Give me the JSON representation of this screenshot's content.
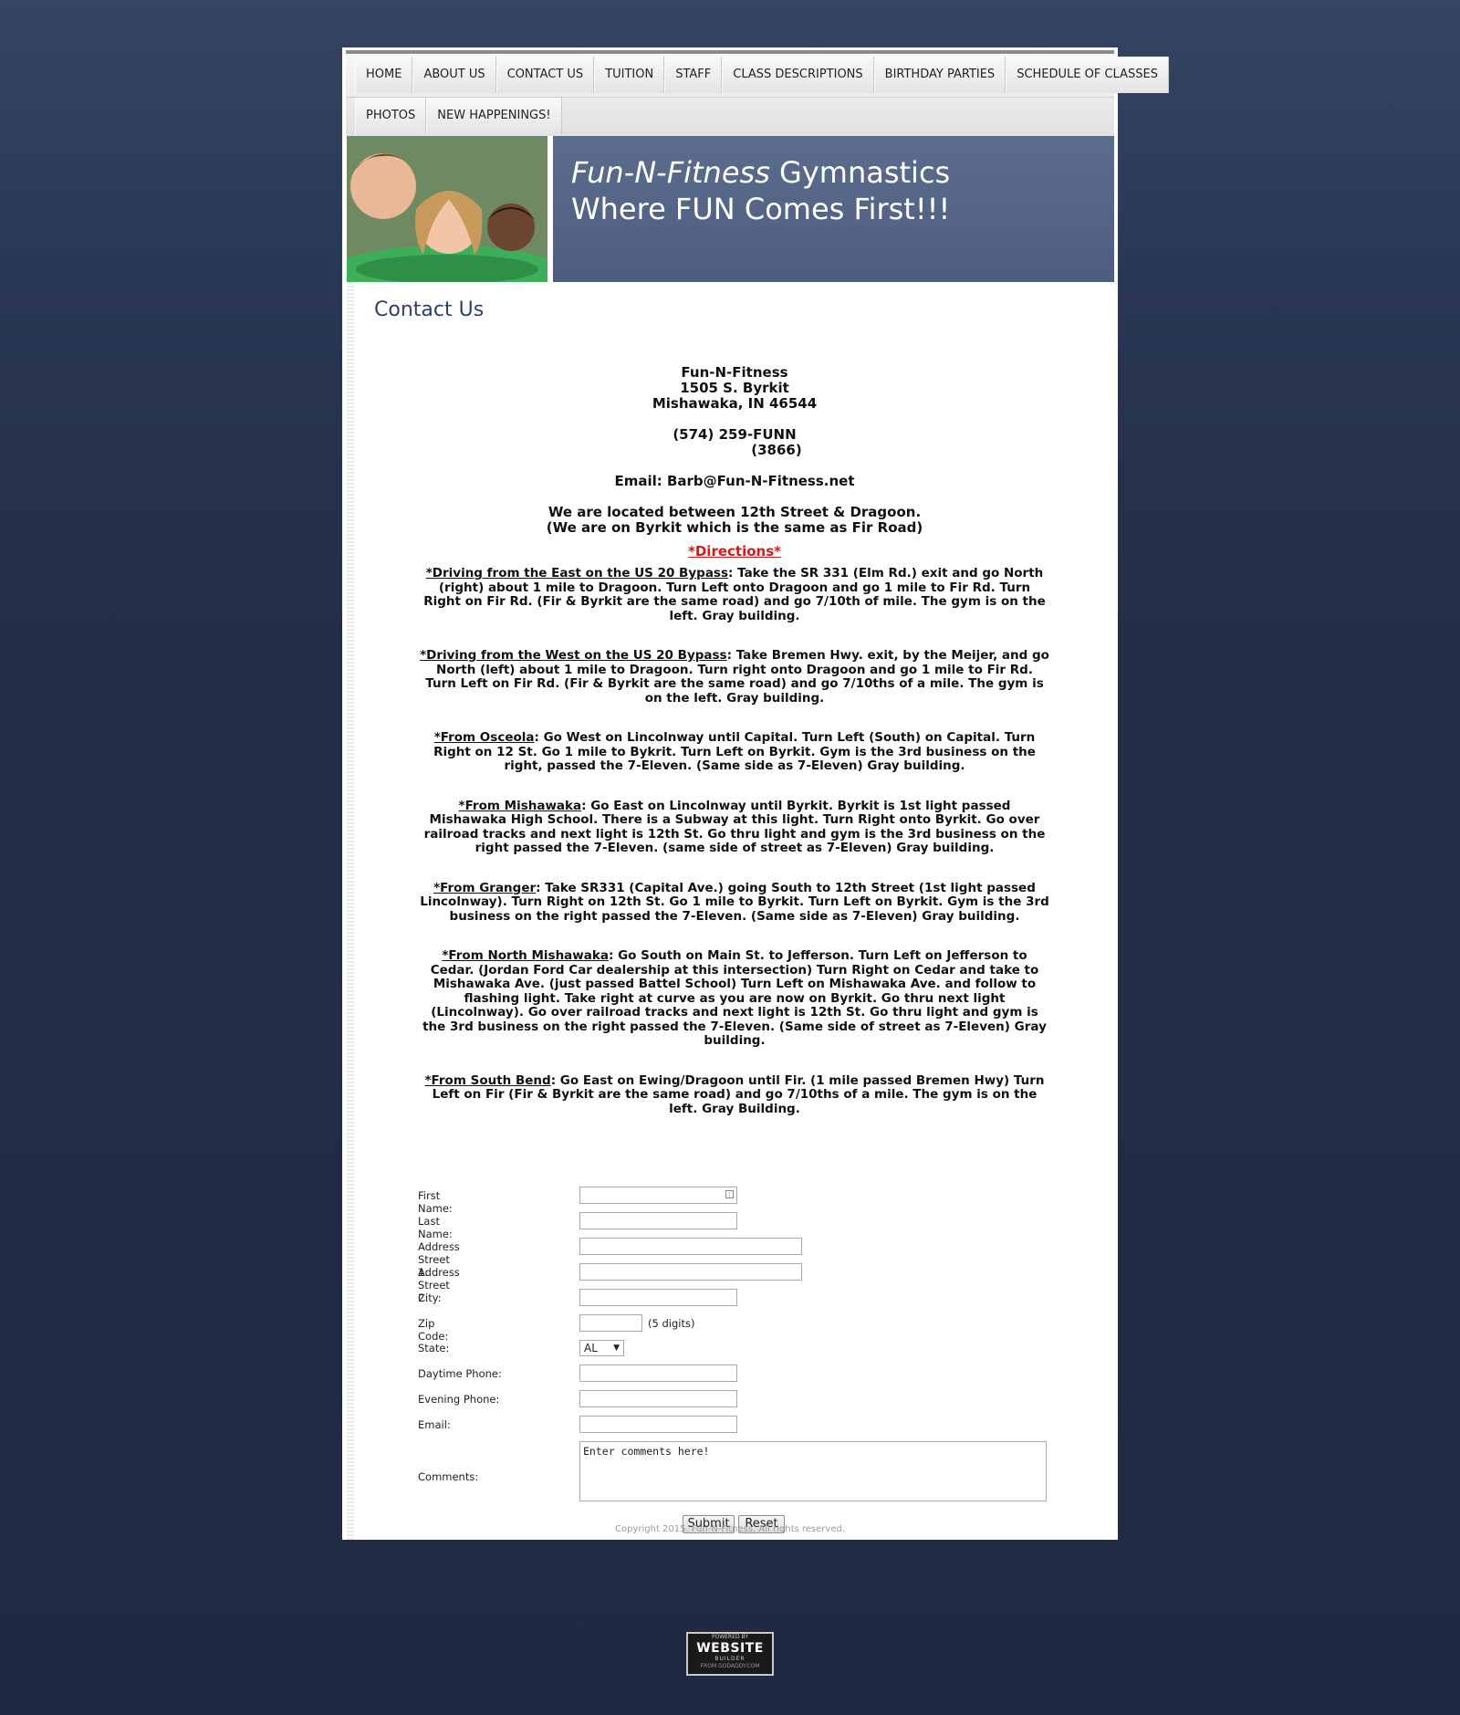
{
  "nav": {
    "row1": [
      "HOME",
      "ABOUT US",
      "CONTACT US",
      "TUITION",
      "STAFF",
      "CLASS DESCRIPTIONS",
      "BIRTHDAY PARTIES",
      "SCHEDULE OF CLASSES"
    ],
    "row2": [
      "PHOTOS",
      "NEW HAPPENINGS!"
    ]
  },
  "banner": {
    "brand": "Fun-N-Fitness",
    "line1_rest": " Gymnastics",
    "line2": "Where FUN Comes First!!!"
  },
  "page_title": "Contact Us",
  "contact": {
    "name": "Fun-N-Fitness",
    "street": "1505 S. Byrkit",
    "city_line": "Mishawaka, IN  46544",
    "phone": "(574) 259-FUNN",
    "phone_digits": "(3866)",
    "email_line": "Email:  Barb@Fun-N-Fitness.net",
    "location1": "We are located between 12th Street & Dragoon.",
    "location2": "(We are on Byrkit which is the same as Fir Road)"
  },
  "directions_heading": "*Directions*",
  "directions": [
    {
      "lead": "*Driving from the East on the US 20 Bypass",
      "text": ":  Take the SR 331 (Elm Rd.) exit and go North (right) about 1 mile to Dragoon.  Turn Left onto Dragoon and go 1 mile to Fir Rd.  Turn Right on Fir Rd. (Fir & Byrkit are the same road) and go 7/10th of mile.  The gym is on the left.  Gray building."
    },
    {
      "lead": "*Driving from the West on the US 20 Bypass",
      "text": ":  Take Bremen Hwy. exit, by the Meijer, and go North (left) about 1 mile to Dragoon.  Turn right onto Dragoon and go 1 mile to Fir Rd.  Turn Left on Fir Rd. (Fir & Byrkit are the same road) and go 7/10ths of a mile.  The gym is on the left.  Gray building."
    },
    {
      "lead": "*From Osceola",
      "text": ":  Go West on Lincolnway until Capital.  Turn Left (South) on Capital. Turn Right on 12 St.  Go 1 mile to Bykrit.  Turn Left on Byrkit.  Gym is the 3rd business on the right, passed the 7-Eleven.  (Same side as 7-Eleven) Gray building."
    },
    {
      "lead": "*From Mishawaka",
      "text": ":  Go East on Lincolnway until Byrkit.  Byrkit is 1st light passed Mishawaka High School.  There is a Subway at this light.  Turn Right onto Byrkit.  Go over railroad tracks and next light is 12th St.  Go thru light and gym is the 3rd business on the right passed the 7-Eleven. (same side of street as 7-Eleven) Gray building."
    },
    {
      "lead": "*From Granger",
      "text": ":  Take SR331 (Capital Ave.) going South to 12th Street (1st light passed Lincolnway).  Turn Right on 12th St.  Go 1 mile to Byrkit.  Turn Left on Byrkit.  Gym is the 3rd business on the right passed the 7-Eleven. (Same side as 7-Eleven) Gray building."
    },
    {
      "lead": "*From North Mishawaka",
      "text": ":  Go South on Main St. to Jefferson.  Turn Left on Jefferson to Cedar. (Jordan Ford Car dealership at this intersection) Turn Right on Cedar and take to Mishawaka Ave. (just passed Battel School) Turn Left on Mishawaka Ave. and follow to flashing light. Take right at curve as you are now on Byrkit.   Go thru next light (Lincolnway). Go over railroad tracks and next light is 12th St.  Go thru light and gym is the 3rd business on the right passed the 7-Eleven. (Same side of street as 7-Eleven) Gray building."
    },
    {
      "lead": "*From South Bend",
      "text": ":  Go East on Ewing/Dragoon until Fir. (1 mile passed Bremen Hwy) Turn Left on Fir (Fir & Byrkit are the same road) and go 7/10ths of a mile.  The gym is on the left.  Gray Building."
    }
  ],
  "form": {
    "first_name": "First Name:",
    "last_name": "Last Name:",
    "street1": "Address Street 1:",
    "street2": "Address Street 2:",
    "city": "City:",
    "zip": "Zip Code:",
    "zip_note": "(5 digits)",
    "state": "State:",
    "state_value": "AL",
    "day_phone": "Daytime Phone:",
    "eve_phone": "Evening Phone:",
    "email": "Email:",
    "comments": "Comments:",
    "comments_value": "Enter comments here!",
    "submit": "Submit",
    "reset": "Reset"
  },
  "footer": {
    "copyright": "Copyright 2015. Fun-N-Fitness. All rights reserved."
  },
  "badge": {
    "powered": "POWERED BY",
    "website": "WEBSITE",
    "builder": "BUILDER",
    "from": "FROM GODADDY.COM"
  }
}
